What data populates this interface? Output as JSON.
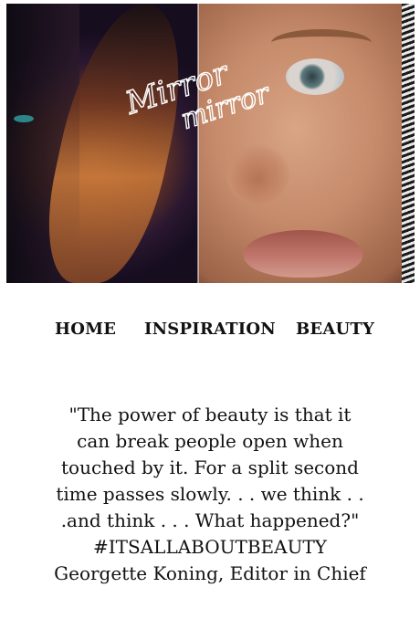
{
  "hero": {
    "logo_line1": "Mirror",
    "logo_line2": "mirror"
  },
  "nav": {
    "items": [
      {
        "label": "HOME"
      },
      {
        "label": "INSPIRATION"
      },
      {
        "label": "BEAUTY"
      }
    ]
  },
  "quote": {
    "lines": [
      "\"The power of beauty is that it",
      "can break people open when",
      "touched by it. For a split second",
      "time passes slowly. . . we think . .",
      ".and think . . . What happened?\""
    ],
    "hashtag": "#ITSALLABOUTBEAUTY",
    "attribution": "Georgette Koning, Editor in Chief"
  }
}
